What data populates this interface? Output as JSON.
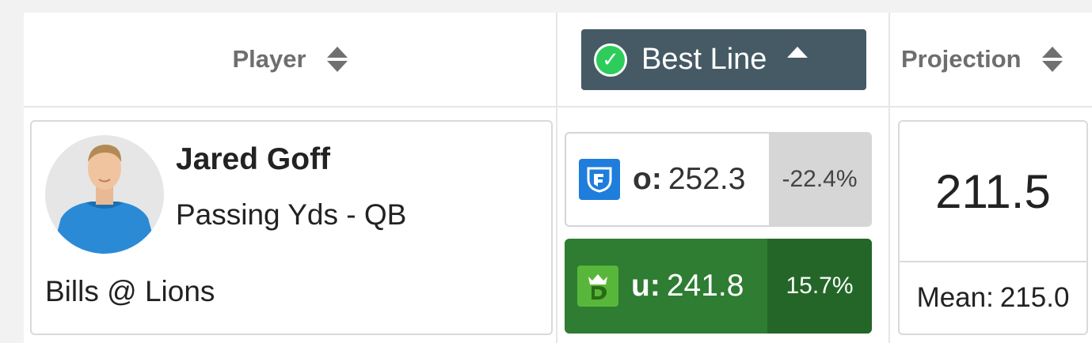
{
  "header": {
    "player_label": "Player",
    "best_line_label": "Best Line",
    "projection_label": "Projection"
  },
  "row": {
    "player": {
      "name": "Jared Goff",
      "market": "Passing Yds - QB",
      "matchup": "Bills @ Lions"
    },
    "lines": [
      {
        "book_icon": "fanduel-logo-icon",
        "side": "o:",
        "value": "252.3",
        "pct": "-22.4%"
      },
      {
        "book_icon": "draftkings-logo-icon",
        "side": "u:",
        "value": "241.8",
        "pct": "15.7%"
      }
    ],
    "projection": {
      "value": "211.5",
      "mean_label": "Mean:",
      "mean_value": "215.0"
    }
  },
  "colors": {
    "best_line_bg": "#455a64",
    "check_green": "#2ecc5b",
    "under_green": "#2e7d32",
    "under_pct_green": "#246628",
    "fanduel_blue": "#1f7ddb",
    "draftkings_green": "#58b73a"
  }
}
